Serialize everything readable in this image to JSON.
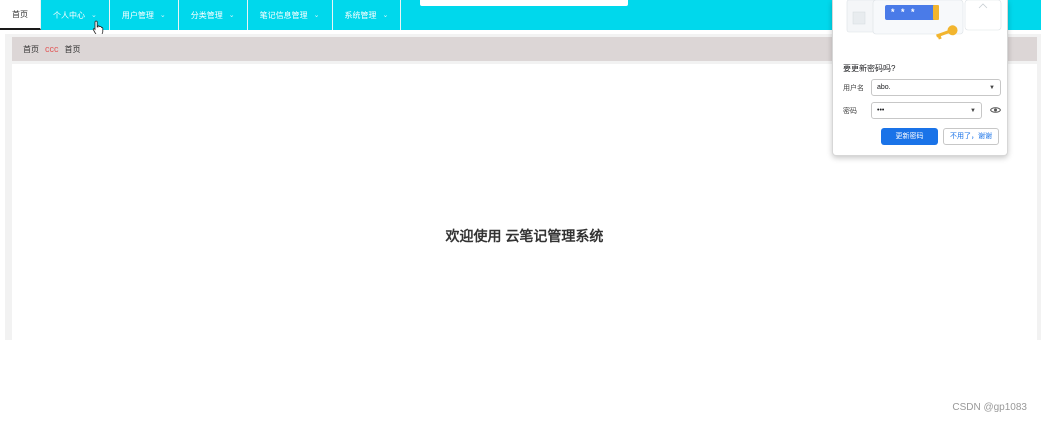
{
  "nav": {
    "items": [
      {
        "label": "首页",
        "active": true,
        "chevron": false
      },
      {
        "label": "个人中心",
        "active": false,
        "chevron": true
      },
      {
        "label": "用户管理",
        "active": false,
        "chevron": true
      },
      {
        "label": "分类管理",
        "active": false,
        "chevron": true
      },
      {
        "label": "笔记信息管理",
        "active": false,
        "chevron": true
      },
      {
        "label": "系统管理",
        "active": false,
        "chevron": true
      }
    ],
    "chevron_glyph": "⌄"
  },
  "breadcrumb": {
    "first": "首页",
    "separator": "ccc",
    "current": "首页"
  },
  "main": {
    "welcome": "欢迎使用 云笔记管理系统"
  },
  "password_popup": {
    "title": "要更新密码吗?",
    "username_label": "用户名",
    "username_value": "abo.",
    "password_label": "密码",
    "password_value": "•••",
    "illustration_mask": "* * *",
    "update_button": "更新密码",
    "no_thanks_button": "不用了，谢谢"
  },
  "watermark": "CSDN @gp1083",
  "colors": {
    "navbar": "#00d8ec",
    "breadcrumb_bg": "#dcd6d6",
    "accent_blue": "#1a73e8",
    "breadcrumb_sep": "#e25a5a"
  }
}
